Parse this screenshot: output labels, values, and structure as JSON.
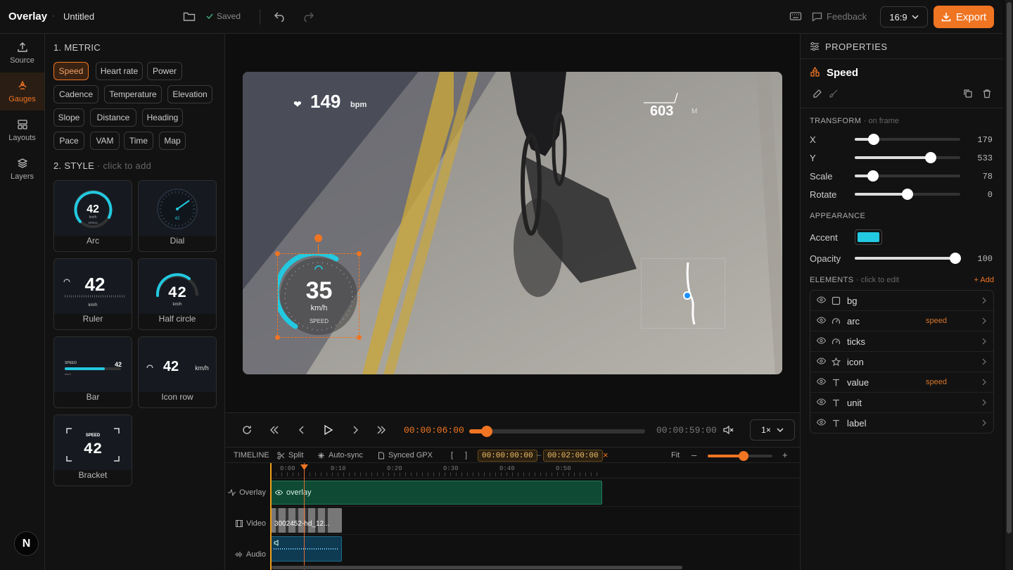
{
  "app": {
    "name": "Overlay",
    "separator": "·",
    "document": "Untitled",
    "saved": "Saved",
    "feedback": "Feedback",
    "aspect": "16:9",
    "export": "Export"
  },
  "rail": {
    "items": [
      {
        "label": "Source",
        "icon": "upload-icon"
      },
      {
        "label": "Gauges",
        "icon": "gauge-icon",
        "active": true
      },
      {
        "label": "Layouts",
        "icon": "layout-icon"
      },
      {
        "label": "Layers",
        "icon": "layers-icon"
      }
    ],
    "badge": "N"
  },
  "gauges": {
    "metric_title": "1. METRIC",
    "metrics": [
      "Speed",
      "Heart rate",
      "Power",
      "Cadence",
      "Temperature",
      "Elevation",
      "Slope",
      "Distance",
      "Heading",
      "Pace",
      "VAM",
      "Time",
      "Map"
    ],
    "active_metric": "Speed",
    "style_title": "2. STYLE",
    "style_hint": "· click to add",
    "styles": [
      "Arc",
      "Dial",
      "Ruler",
      "Half circle",
      "Bar",
      "Icon row",
      "Bracket"
    ],
    "preview": {
      "value": "42",
      "unit": "km/h",
      "label": "SPEED",
      "dial_value": "42"
    }
  },
  "overlay": {
    "hr_value": "149",
    "hr_unit": "bpm",
    "elev_value": "603",
    "elev_unit": "M",
    "speed_value": "35",
    "speed_unit": "km/h",
    "speed_label": "SPEED"
  },
  "transport": {
    "current": "00:00:06:00",
    "end": "00:00:59:00",
    "progress": 0.1,
    "speed": "1×"
  },
  "timeline": {
    "title": "TIMELINE",
    "split": "Split",
    "autosync": "Auto-sync",
    "synced": "Synced GPX",
    "bracket_open": "[",
    "bracket_close": "]",
    "in": "00:00:00:00",
    "dash": "–",
    "out": "00:02:00:00",
    "clear": "×",
    "fit": "Fit",
    "minus": "–",
    "plus": "+",
    "zoom": 0.55,
    "ticks": [
      "0:00",
      "0:10",
      "0:20",
      "0:30",
      "0:40",
      "0:50"
    ],
    "tracks": [
      {
        "name": "Overlay",
        "clip": "overlay"
      },
      {
        "name": "Video",
        "clip": "3002452-hd_12..."
      },
      {
        "name": "Audio",
        "clip": ""
      }
    ]
  },
  "properties": {
    "title": "PROPERTIES",
    "element": "Speed",
    "transform": {
      "title": "TRANSFORM",
      "hint": "· on frame",
      "rows": [
        {
          "label": "X",
          "value": "179",
          "pct": 0.18
        },
        {
          "label": "Y",
          "value": "533",
          "pct": 0.72
        },
        {
          "label": "Scale",
          "value": "78",
          "pct": 0.17
        },
        {
          "label": "Rotate",
          "value": "0",
          "pct": 0.5
        }
      ]
    },
    "appearance": {
      "title": "APPEARANCE",
      "accent_label": "Accent",
      "accent_color": "#22c9e0",
      "opacity_label": "Opacity",
      "opacity": "100",
      "opacity_pct": 0.95
    },
    "elements": {
      "title": "ELEMENTS",
      "hint": "· click to edit",
      "add": "+ Add",
      "rows": [
        {
          "name": "bg",
          "icon": "square-icon",
          "tag": ""
        },
        {
          "name": "arc",
          "icon": "gauge-icon",
          "tag": "speed"
        },
        {
          "name": "ticks",
          "icon": "gauge-icon",
          "tag": ""
        },
        {
          "name": "icon",
          "icon": "star-icon",
          "tag": ""
        },
        {
          "name": "value",
          "icon": "text-icon",
          "tag": "speed"
        },
        {
          "name": "unit",
          "icon": "text-icon",
          "tag": ""
        },
        {
          "name": "label",
          "icon": "text-icon",
          "tag": ""
        }
      ]
    }
  },
  "colors": {
    "accent": "#f07522",
    "gauge": "#22c9e0"
  }
}
